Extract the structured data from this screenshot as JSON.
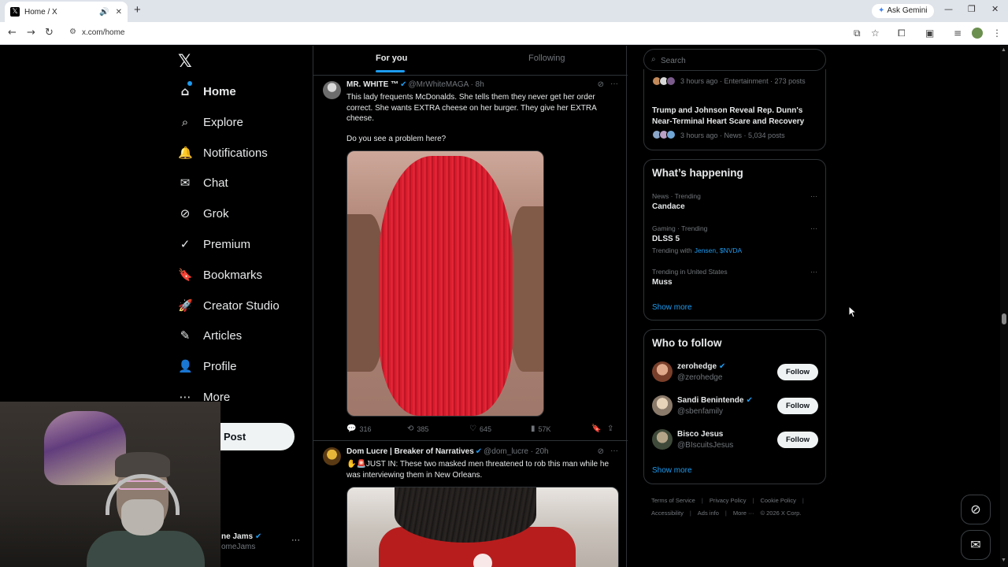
{
  "browser": {
    "tab_title": "Home / X",
    "tab_favicon": "𝕏",
    "new_tab": "+",
    "ask_gemini": "Ask Gemini",
    "url": "x.com/home",
    "icons": [
      "back-icon",
      "forward-icon",
      "reload-icon",
      "site-info-icon",
      "install-icon",
      "star-icon",
      "extensions-icon",
      "split-icon",
      "media-icon",
      "profile-icon",
      "menu-icon"
    ]
  },
  "nav": {
    "logo": "𝕏",
    "items": [
      {
        "label": "Home",
        "icon": "⌂"
      },
      {
        "label": "Explore",
        "icon": "⌕"
      },
      {
        "label": "Notifications",
        "icon": "🔔"
      },
      {
        "label": "Chat",
        "icon": "✉"
      },
      {
        "label": "Grok",
        "icon": "⊘"
      },
      {
        "label": "Premium",
        "icon": "✓"
      },
      {
        "label": "Bookmarks",
        "icon": "🔖"
      },
      {
        "label": "Creator Studio",
        "icon": "🚀"
      },
      {
        "label": "Articles",
        "icon": "✎"
      },
      {
        "label": "Profile",
        "icon": "👤"
      },
      {
        "label": "More",
        "icon": "⋯"
      }
    ],
    "post_label": "Post",
    "account_name": "ne Jams",
    "account_handle": "omeJams",
    "account_more": "···"
  },
  "feed": {
    "tabs": {
      "for_you": "For you",
      "following": "Following"
    },
    "tweets": [
      {
        "name": "MR. WHITE ™",
        "handle": "@MrWhiteMAGA",
        "time": "· 8h",
        "text": "This lady frequents McDonalds. She tells them they never get her order correct. She wants EXTRA cheese on her burger. They give her EXTRA cheese.",
        "text2": "Do you see a problem here?",
        "replies": "316",
        "reposts": "385",
        "likes": "645",
        "views": "57K"
      },
      {
        "name": "Dom Lucre | Breaker of Narratives",
        "handle": "@dom_lucre",
        "time": "· 20h",
        "text": "✋🚨JUST IN: These two masked men threatened to rob this man while he was interviewing them in New Orleans."
      }
    ]
  },
  "sidebar": {
    "search_placeholder": "Search",
    "news": [
      {
        "meta": "3 hours ago · Entertainment · 273 posts"
      },
      {
        "title": "Trump and Johnson Reveal Rep. Dunn's Near-Terminal Heart Scare and Recovery",
        "meta": "3 hours ago · News · 5,034 posts"
      }
    ],
    "whats_happening": {
      "title": "What’s happening",
      "trends": [
        {
          "category": "News · Trending",
          "name": "Candace"
        },
        {
          "category": "Gaming · Trending",
          "name": "DLSS 5",
          "with_label": "Trending with",
          "with": "Jensen, $NVDA"
        },
        {
          "category": "Trending in United States",
          "name": "Muss"
        }
      ],
      "show_more": "Show more"
    },
    "who_to_follow": {
      "title": "Who to follow",
      "accounts": [
        {
          "name": "zerohedge",
          "handle": "@zerohedge",
          "button": "Follow"
        },
        {
          "name": "Sandi Benintende",
          "handle": "@sbenfamily",
          "button": "Follow"
        },
        {
          "name": "Bisco Jesus",
          "handle": "@BIscuitsJesus",
          "button": "Follow"
        }
      ],
      "show_more": "Show more"
    },
    "footer": {
      "terms": "Terms of Service",
      "privacy": "Privacy Policy",
      "cookie": "Cookie Policy",
      "access": "Accessibility",
      "ads": "Ads info",
      "more": "More ···",
      "copyright": "© 2026 X Corp.",
      "sep": "|"
    }
  },
  "colors": {
    "accent": "#1d9bf0",
    "background": "#000000",
    "border": "#2f3336",
    "muted": "#71767b"
  }
}
